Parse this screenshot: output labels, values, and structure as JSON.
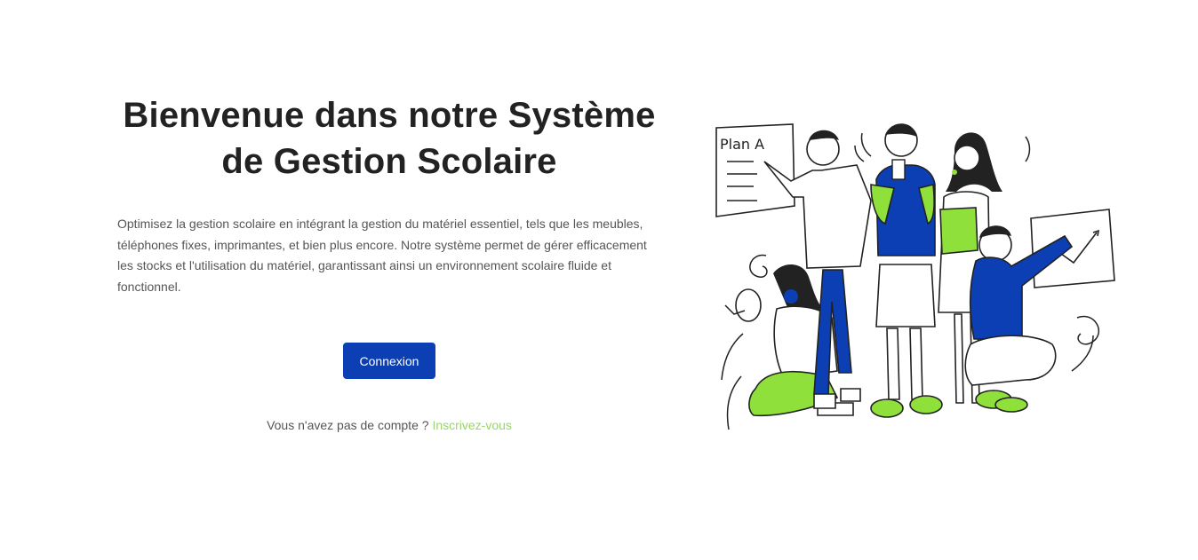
{
  "hero": {
    "title": "Bienvenue dans notre Système de Gestion Scolaire",
    "description": "Optimisez la gestion scolaire en intégrant la gestion du matériel essentiel, tels que les meubles, téléphones fixes, imprimantes, et bien plus encore. Notre système permet de gérer efficacement les stocks et l'utilisation du matériel, garantissant ainsi un environnement scolaire fluide et fonctionnel."
  },
  "actions": {
    "login_label": "Connexion",
    "signup_prompt": "Vous n'avez pas de compte ?",
    "signup_link": "Inscrivez-vous"
  },
  "illustration": {
    "board_text": "Plan A"
  },
  "colors": {
    "primary": "#0b3fb3",
    "accent_green": "#9ad66a",
    "illustration_green": "#8fe03a",
    "illustration_blue": "#0b3fb3"
  }
}
